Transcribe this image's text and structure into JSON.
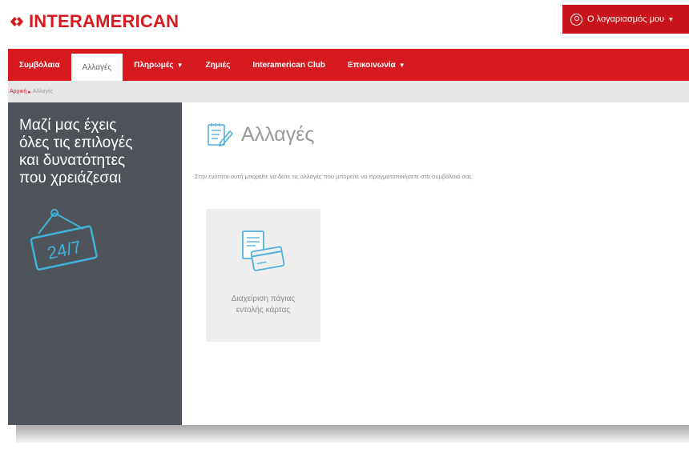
{
  "brand": {
    "name": "INTERAMERICAN",
    "color": "#d71920"
  },
  "account": {
    "label": "Ο λογαριασμός μου",
    "icon": "user-icon"
  },
  "nav": {
    "items": [
      {
        "label": "Συμβόλαια",
        "has_dropdown": false,
        "active": false
      },
      {
        "label": "Αλλαγές",
        "has_dropdown": false,
        "active": true
      },
      {
        "label": "Πληρωμές",
        "has_dropdown": true,
        "active": false
      },
      {
        "label": "Ζημιές",
        "has_dropdown": false,
        "active": false
      },
      {
        "label": "Interamerican Club",
        "has_dropdown": false,
        "active": false
      },
      {
        "label": "Επικοινωνία",
        "has_dropdown": true,
        "active": false
      }
    ]
  },
  "breadcrumb": {
    "home": "Αρχική",
    "separator": "▸",
    "current": "Αλλαγές"
  },
  "sidebar": {
    "lines": [
      "Μαζί μας έχεις",
      "όλες τις επιλογές",
      "και δυνατότητες",
      "που χρειάζεσαι"
    ],
    "sign_text": "24/7",
    "icon": "24-7-sign-icon"
  },
  "main": {
    "title": "Αλλαγές",
    "title_icon": "edit-document-icon",
    "description": "Στην ενότητα αυτή μπορείτε να δείτε τις αλλαγές που μπορείτε να πραγματοποιήσετε στα συμβόλαιά σας",
    "tiles": [
      {
        "label_line1": "Διαχείριση πάγιας",
        "label_line2": "εντολής κάρτας",
        "icon": "card-document-icon"
      }
    ]
  },
  "colors": {
    "accent": "#d71920",
    "sidebar": "#4e5359",
    "tile": "#eeeeee",
    "icon_blue": "#4fb3d9"
  }
}
